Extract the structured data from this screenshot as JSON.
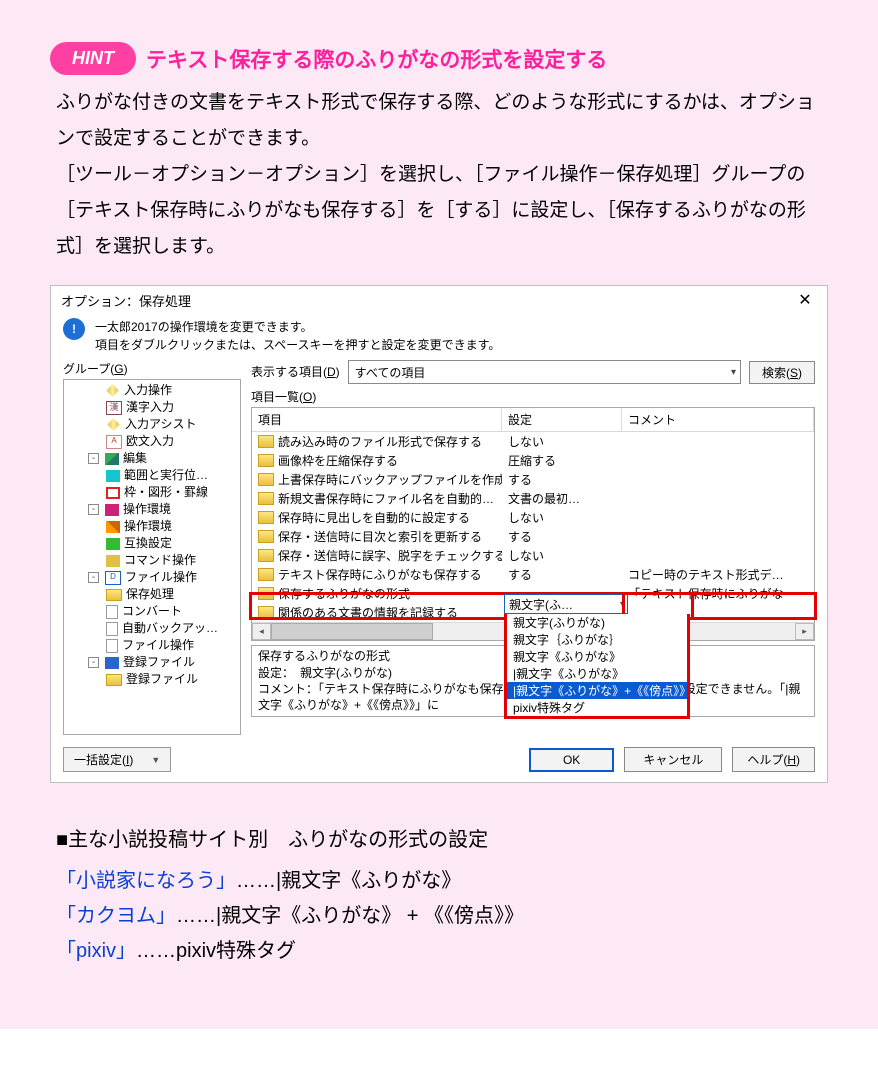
{
  "hint": {
    "pill": "HINT",
    "title": "テキスト保存する際のふりがなの形式を設定する"
  },
  "paragraph": "ふりがな付きの文書をテキスト形式で保存する際、どのような形式にするかは、オプションで設定することができます。\n［ツール－オプション－オプション］を選択し、［ファイル操作－保存処理］グループの［テキスト保存時にふりがなも保存する］を［する］に設定し、［保存するふりがなの形式］を選択します。",
  "dialog": {
    "title": "オプション：保存処理",
    "info1": "一太郎2017の操作環境を変更できます。",
    "info2": "項目をダブルクリックまたは、スペースキーを押すと設定を変更できます。",
    "group_label": {
      "text": "グループ(",
      "key": "G",
      "after": ")"
    },
    "disp_label": {
      "text": "表示する項目(",
      "key": "D",
      "after": ")"
    },
    "disp_value": "すべての項目",
    "search_btn": {
      "text": "検索(",
      "key": "S",
      "after": ")"
    },
    "list_label": {
      "text": "項目一覧(",
      "key": "O",
      "after": ")"
    },
    "tree": [
      {
        "lvl": 1,
        "ico": "diamond",
        "t": "入力操作"
      },
      {
        "lvl": 2,
        "ico": "han",
        "t": "漢字入力"
      },
      {
        "lvl": 2,
        "ico": "diamond",
        "t": "入力アシスト"
      },
      {
        "lvl": 2,
        "ico": "aa",
        "t": "欧文入力"
      },
      {
        "lvl": 1,
        "tog": "-",
        "ico": "pen",
        "t": "編集"
      },
      {
        "lvl": 2,
        "ico": "sel",
        "t": "範囲と実行位…"
      },
      {
        "lvl": 2,
        "ico": "frame",
        "t": "枠・図形・罫線"
      },
      {
        "lvl": 1,
        "tog": "-",
        "ico": "joy",
        "t": "操作環境"
      },
      {
        "lvl": 2,
        "ico": "wrench",
        "t": "操作環境"
      },
      {
        "lvl": 2,
        "ico": "inter",
        "t": "互換設定"
      },
      {
        "lvl": 2,
        "ico": "cmd",
        "t": "コマンド操作"
      },
      {
        "lvl": 1,
        "tog": "-",
        "ico": "file",
        "t": "ファイル操作"
      },
      {
        "lvl": 2,
        "ico": "folder",
        "t": "保存処理"
      },
      {
        "lvl": 2,
        "ico": "doc",
        "t": "コンバート"
      },
      {
        "lvl": 2,
        "ico": "doc",
        "t": "自動バックアッ…"
      },
      {
        "lvl": 2,
        "ico": "doc",
        "t": "ファイル操作"
      },
      {
        "lvl": 1,
        "tog": "-",
        "ico": "reg",
        "t": "登録ファイル"
      },
      {
        "lvl": 2,
        "ico": "folder",
        "t": "登録ファイル"
      }
    ],
    "columns": {
      "c1": "項目",
      "c2": "設定",
      "c3": "コメント"
    },
    "rows": [
      {
        "c1": "読み込み時のファイル形式で保存する",
        "c2": "しない",
        "c3": ""
      },
      {
        "c1": "画像枠を圧縮保存する",
        "c2": "圧縮する",
        "c3": ""
      },
      {
        "c1": "上書保存時にバックアップファイルを作成…",
        "c2": "する",
        "c3": ""
      },
      {
        "c1": "新規文書保存時にファイル名を自動的…",
        "c2": "文書の最初…",
        "c3": ""
      },
      {
        "c1": "保存時に見出しを自動的に設定する",
        "c2": "しない",
        "c3": ""
      },
      {
        "c1": "保存・送信時に目次と索引を更新する",
        "c2": "する",
        "c3": ""
      },
      {
        "c1": "保存・送信時に誤字、脱字をチェックする",
        "c2": "しない",
        "c3": ""
      },
      {
        "c1": "テキスト保存時にふりがなも保存する",
        "c2": "する",
        "c3": "コピー時のテキスト形式デ…"
      },
      {
        "c1": "保存するふりがなの形式",
        "c2": "親文字(ふ…",
        "c3": "「テキスト保存時にふりがな"
      },
      {
        "c1": "関係のある文書の情報を記録する",
        "c2": "",
        "c3": ""
      }
    ],
    "dropdown": [
      "親文字(ふりがな)",
      "親文字｛ふりがな｝",
      "親文字《ふりがな》",
      "|親文字《ふりがな》",
      "|親文字《ふりがな》+《《傍点》》",
      "pixiv特殊タグ"
    ],
    "desc": "保存するふりがなの形式\n設定：　親文字(ふりがな)\nコメント：「テキスト保存時にふりがなも保存する」を「しない」にしたときは設定できません。「|親文字《ふりがな》+《《傍点》》」に",
    "batch": {
      "text": "一括設定(",
      "key": "I",
      "after": ")"
    },
    "ok": "OK",
    "cancel": "キャンセル",
    "help": {
      "text": "ヘルプ(",
      "key": "H",
      "after": ")"
    }
  },
  "subhead": "■主な小説投稿サイト別　ふりがなの形式の設定",
  "sites": [
    {
      "name": "「小説家になろう」",
      "rest": "……|親文字《ふりがな》"
    },
    {
      "name": "「カクヨム」",
      "rest": "……|親文字《ふりがな》 + 《《傍点》》"
    },
    {
      "name": "「pixiv」",
      "rest": "……pixiv特殊タグ"
    }
  ]
}
